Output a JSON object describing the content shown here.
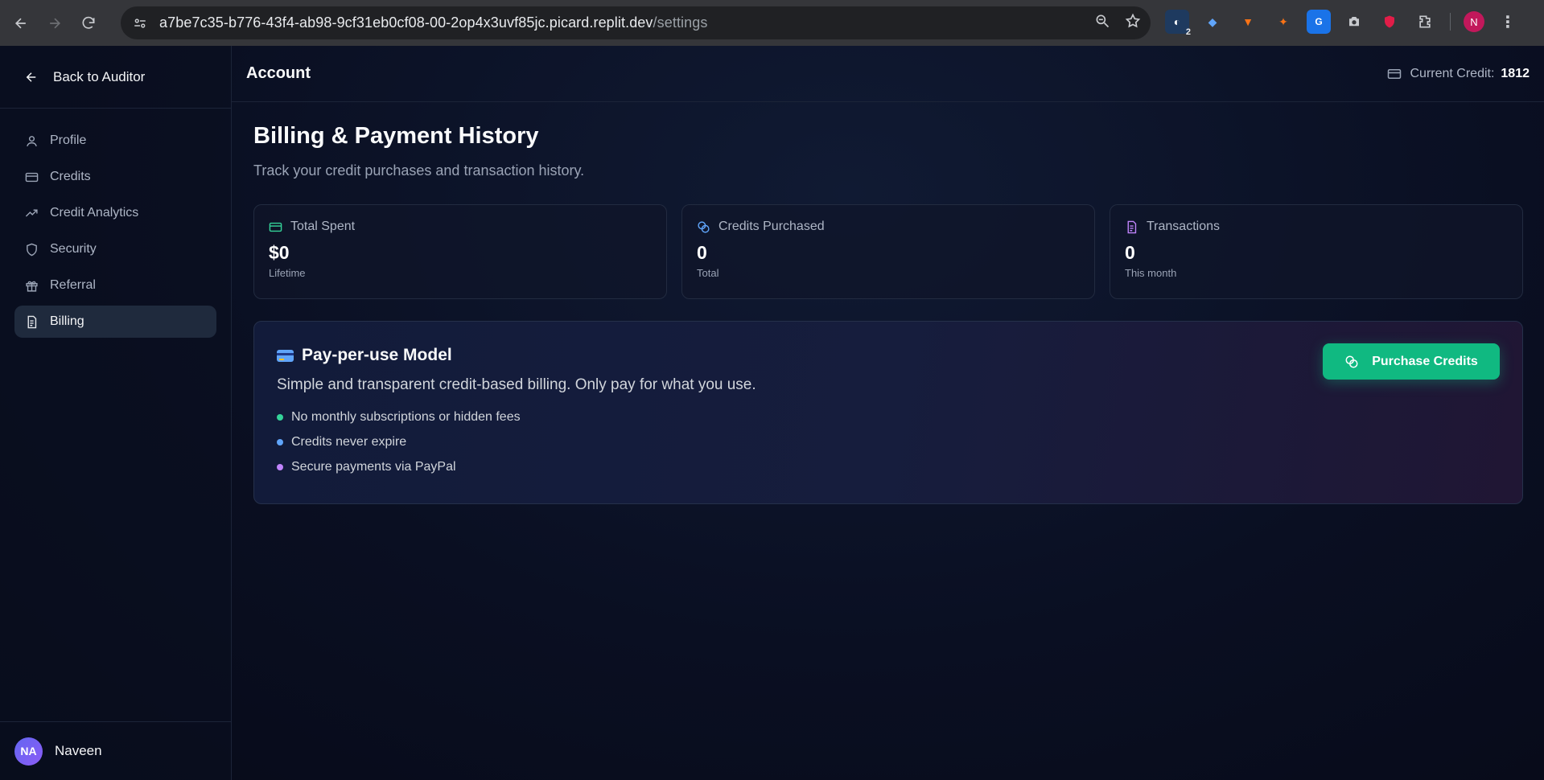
{
  "browser": {
    "url_host": "a7be7c35-b776-43f4-ab98-9cf31eb0cf08-00-2op4x3uvf85jc.picard.replit.dev",
    "url_path": "/settings",
    "ext_badge": "2",
    "profile_initial": "N"
  },
  "sidebar": {
    "back_label": "Back to Auditor",
    "items": [
      {
        "label": "Profile",
        "icon": "user-icon"
      },
      {
        "label": "Credits",
        "icon": "credit-card-icon"
      },
      {
        "label": "Credit Analytics",
        "icon": "trending-up-icon"
      },
      {
        "label": "Security",
        "icon": "shield-icon"
      },
      {
        "label": "Referral",
        "icon": "gift-icon"
      },
      {
        "label": "Billing",
        "icon": "receipt-icon",
        "active": true
      }
    ],
    "user": {
      "initials": "NA",
      "name": "Naveen"
    }
  },
  "header": {
    "title": "Account",
    "credit_label": "Current Credit:",
    "credit_value": "1812"
  },
  "page": {
    "title": "Billing & Payment History",
    "subtitle": "Track your credit purchases and transaction history."
  },
  "stats": [
    {
      "label": "Total Spent",
      "value": "$0",
      "note": "Lifetime",
      "color": "#34d399"
    },
    {
      "label": "Credits Purchased",
      "value": "0",
      "note": "Total",
      "color": "#60a5fa"
    },
    {
      "label": "Transactions",
      "value": "0",
      "note": "This month",
      "color": "#c084fc"
    }
  ],
  "promo": {
    "title": "Pay-per-use Model",
    "description": "Simple and transparent credit-based billing. Only pay for what you use.",
    "bullets": [
      {
        "text": "No monthly subscriptions or hidden fees",
        "color": "#34d399"
      },
      {
        "text": "Credits never expire",
        "color": "#60a5fa"
      },
      {
        "text": "Secure payments via PayPal",
        "color": "#c084fc"
      }
    ],
    "button_label": "Purchase Credits"
  }
}
